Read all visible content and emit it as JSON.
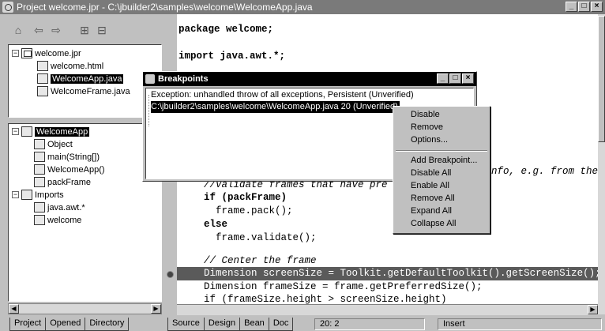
{
  "window": {
    "title": "Project welcome.jpr - C:\\jbuilder2\\samples\\welcome\\WelcomeApp.java",
    "min": "_",
    "max": "□",
    "close": "×"
  },
  "toolbar": {
    "home_icon": "⌂",
    "back_icon": "⇦",
    "forward_icon": "⇨",
    "add_icon": "⊞",
    "remove_icon": "⊟"
  },
  "project_tree": {
    "root": "welcome.jpr",
    "items": [
      "welcome.html",
      "WelcomeApp.java",
      "WelcomeFrame.java"
    ]
  },
  "structure_tree": {
    "root": "WelcomeApp",
    "members": [
      "Object",
      "main(String[])",
      "WelcomeApp()",
      "packFrame"
    ],
    "imports_label": "Imports",
    "imports": [
      "java.awt.*",
      "welcome"
    ]
  },
  "left_tabs": [
    "Project",
    "Opened",
    "Directory"
  ],
  "editor_tabs": [
    "Source",
    "Design",
    "Bean",
    "Doc"
  ],
  "status": {
    "position": "20:  2",
    "mode": "Insert"
  },
  "code_lines": [
    "package welcome;",
    "",
    "import java.awt.*;",
    "//Validate frames that have pre",
    "if (packFrame)",
    "  frame.pack();",
    "else",
    "  frame.validate();",
    "",
    "// Center the frame",
    "Dimension screenSize = Toolkit.getDefaultToolkit().getScreenSize();",
    "Dimension frameSize = frame.getPreferredSize();",
    "if (frameSize.height > screenSize.height)"
  ],
  "code_fragment_right": "nfo, e.g. from the",
  "breakpoints_dialog": {
    "title": "Breakpoints",
    "entries": [
      "Exception: unhandled throw  of all exceptions, Persistent (Unverified)",
      "C:\\jbuilder2\\samples\\welcome\\WelcomeApp.java 20 (Unverified)"
    ]
  },
  "context_menu": {
    "group1": [
      "Disable",
      "Remove",
      "Options..."
    ],
    "group2": [
      "Add Breakpoint...",
      "Disable All",
      "Enable All",
      "Remove All",
      "Expand All",
      "Collapse All"
    ]
  }
}
